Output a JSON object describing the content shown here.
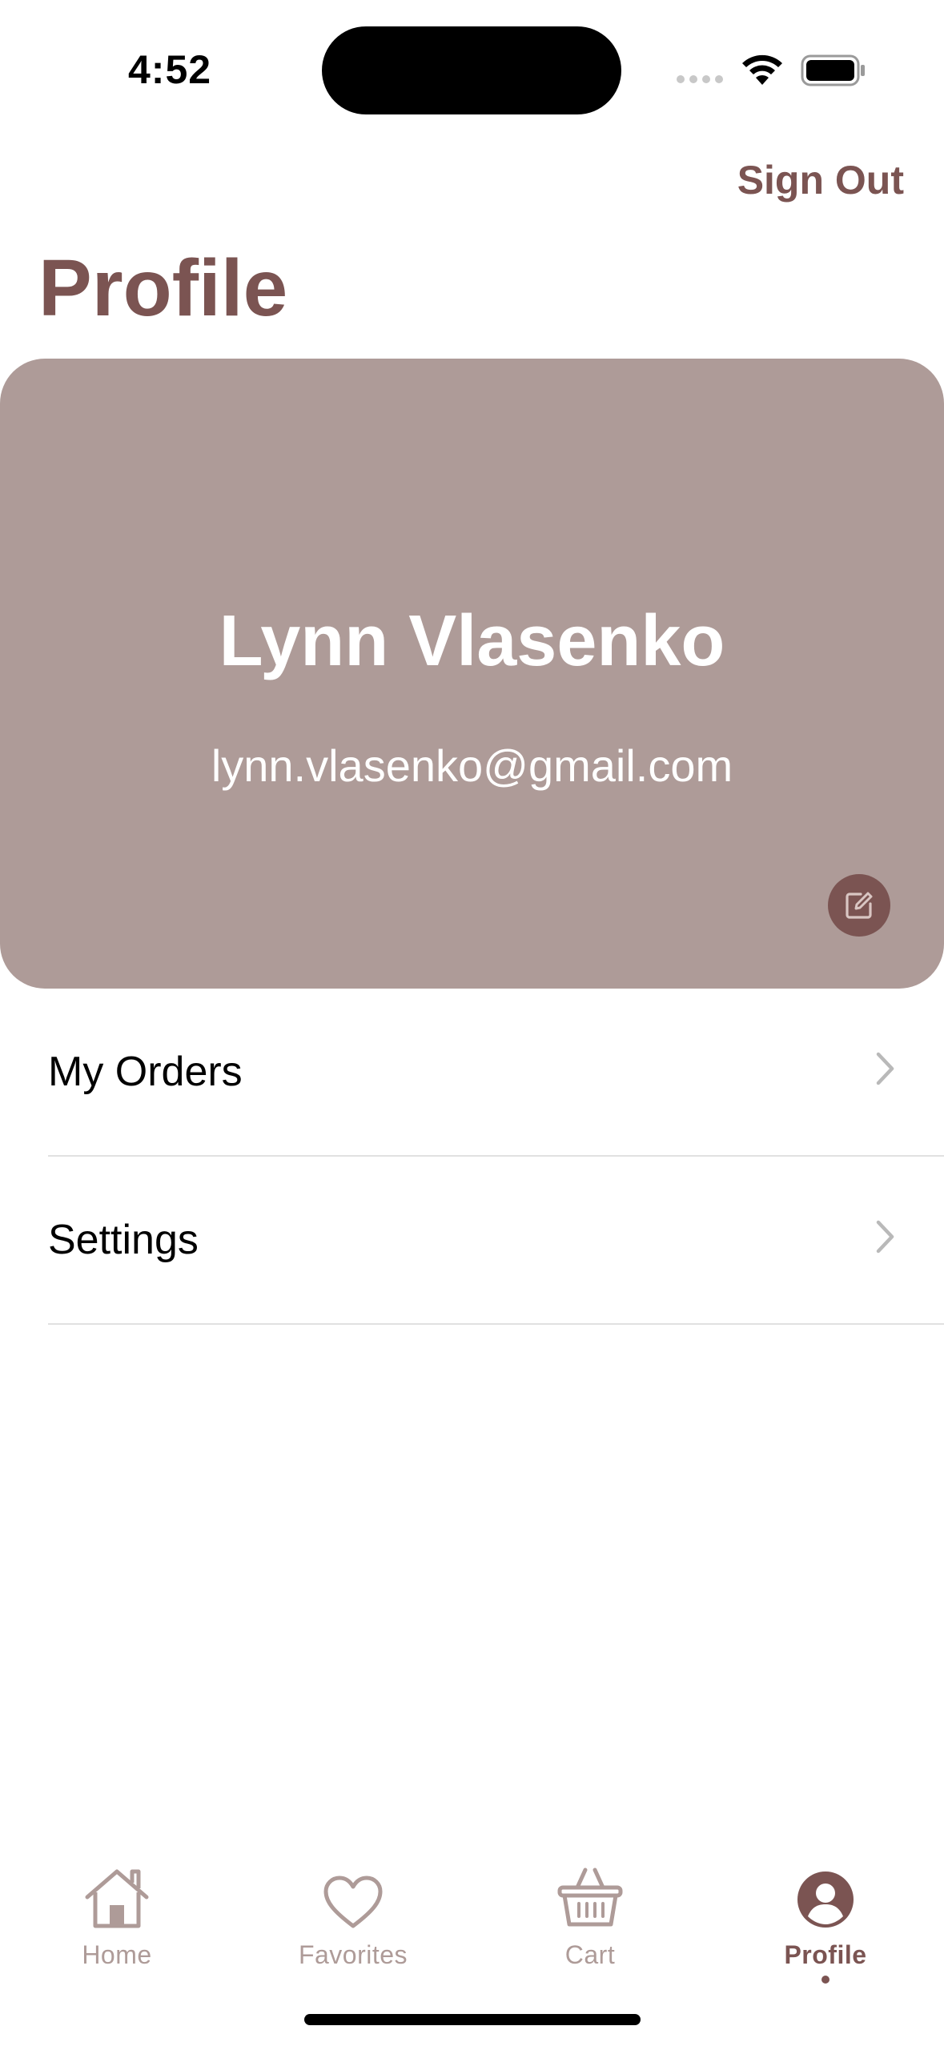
{
  "status_bar": {
    "time": "4:52"
  },
  "header": {
    "sign_out_label": "Sign Out",
    "title": "Profile"
  },
  "profile_card": {
    "name": "Lynn Vlasenko",
    "email": "lynn.vlasenko@gmail.com",
    "background_color": "#ae9b98",
    "edit_icon": "edit-icon"
  },
  "menu": {
    "items": [
      {
        "label": "My Orders",
        "icon": "chevron-right-icon"
      },
      {
        "label": "Settings",
        "icon": "chevron-right-icon"
      }
    ]
  },
  "tab_bar": {
    "tabs": [
      {
        "label": "Home",
        "icon": "home-icon",
        "active": false
      },
      {
        "label": "Favorites",
        "icon": "heart-icon",
        "active": false
      },
      {
        "label": "Cart",
        "icon": "basket-icon",
        "active": false
      },
      {
        "label": "Profile",
        "icon": "person-circle-icon",
        "active": true
      }
    ]
  },
  "colors": {
    "accent": "#7b5452",
    "muted": "#ae9b98",
    "divider": "#e1e1e1"
  }
}
